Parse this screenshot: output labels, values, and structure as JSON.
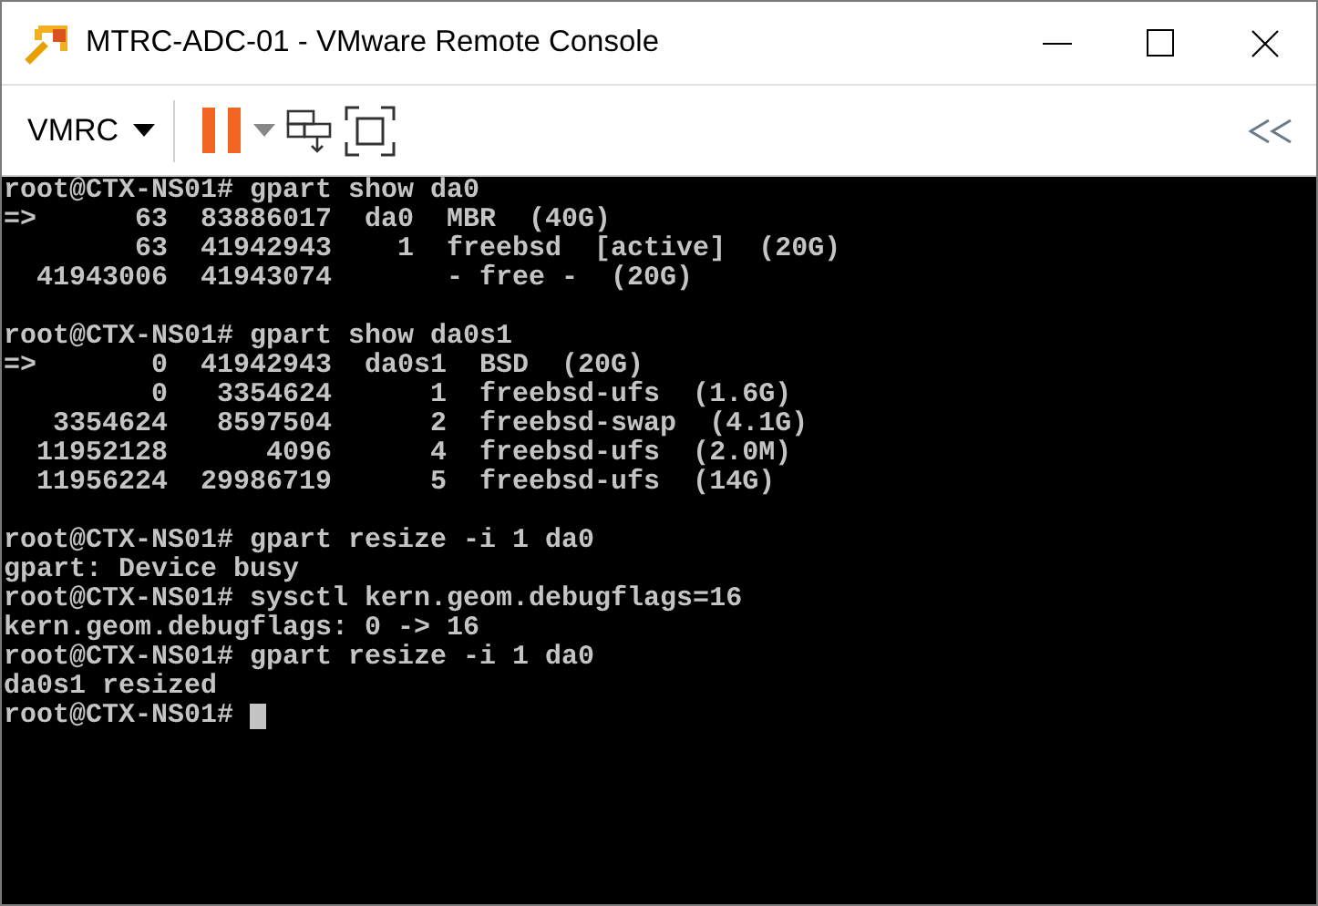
{
  "window": {
    "title": "MTRC-ADC-01 - VMware Remote Console"
  },
  "toolbar": {
    "menu_label": "VMRC"
  },
  "terminal": {
    "cursor": true,
    "blocks": [
      [
        "root@CTX-NS01# gpart show da0",
        "=>      63  83886017  da0  MBR  (40G)",
        "        63  41942943    1  freebsd  [active]  (20G)",
        "  41943006  41943074       - free -  (20G)"
      ],
      [
        "root@CTX-NS01# gpart show da0s1",
        "=>       0  41942943  da0s1  BSD  (20G)",
        "         0   3354624      1  freebsd-ufs  (1.6G)",
        "   3354624   8597504      2  freebsd-swap  (4.1G)",
        "  11952128      4096      4  freebsd-ufs  (2.0M)",
        "  11956224  29986719      5  freebsd-ufs  (14G)"
      ],
      [
        "root@CTX-NS01# gpart resize -i 1 da0",
        "gpart: Device busy",
        "root@CTX-NS01# sysctl kern.geom.debugflags=16",
        "kern.geom.debugflags: 0 -> 16",
        "root@CTX-NS01# gpart resize -i 1 da0",
        "da0s1 resized",
        "root@CTX-NS01# "
      ]
    ]
  }
}
